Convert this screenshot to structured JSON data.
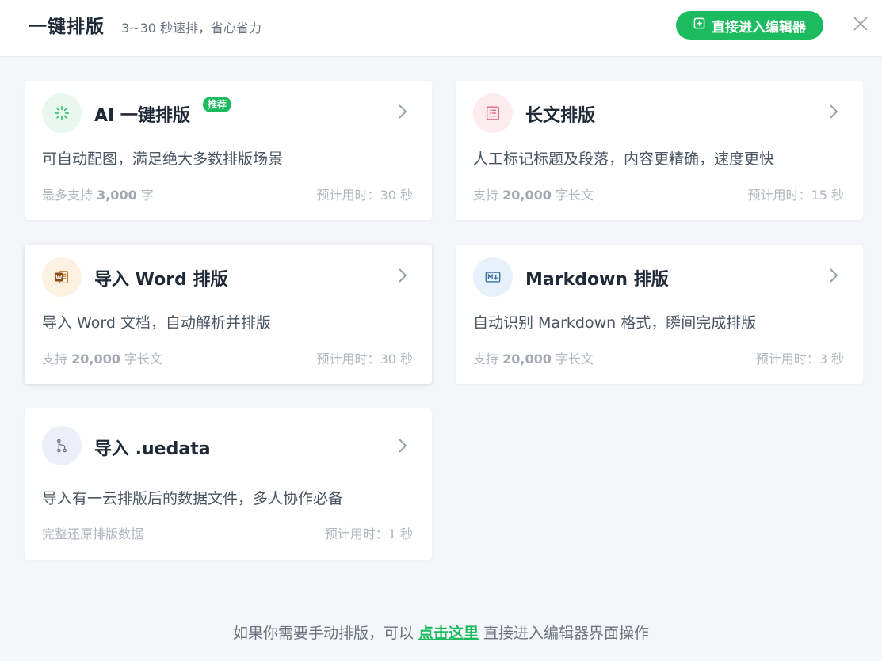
{
  "header": {
    "title": "一键排版",
    "subtitle": "3~30 秒速排，省心省力",
    "enter_editor_label": "直接进入编辑器"
  },
  "cards": [
    {
      "title": "AI 一键排版",
      "badge": "推荐",
      "description": "可自动配图，满足绝大多数排版场景",
      "meta_prefix": "最多支持 ",
      "meta_value": "3,000",
      "meta_suffix": " 字",
      "time": "预计用时：30 秒",
      "icon": "sparkle-icon",
      "icon_bg": "#e8f8ee",
      "icon_color": "#1dbb5f"
    },
    {
      "title": "长文排版",
      "description": "人工标记标题及段落，内容更精确，速度更快",
      "meta_prefix": "支持 ",
      "meta_value": "20,000",
      "meta_suffix": " 字长文",
      "time": "预计用时：15 秒",
      "icon": "list-document-icon",
      "icon_bg": "#fdecef",
      "icon_color": "#e46a85"
    },
    {
      "title": "导入 Word 排版",
      "description": "导入 Word 文档，自动解析并排版",
      "meta_prefix": "支持 ",
      "meta_value": "20,000",
      "meta_suffix": " 字长文",
      "time": "预计用时：30 秒",
      "icon": "word-icon",
      "icon_bg": "#fdf1e2",
      "icon_color": "#c4772b"
    },
    {
      "title": "Markdown 排版",
      "description": "自动识别 Markdown 格式，瞬间完成排版",
      "meta_prefix": "支持 ",
      "meta_value": "20,000",
      "meta_suffix": " 字长文",
      "time": "预计用时：3 秒",
      "icon": "markdown-icon",
      "icon_bg": "#e6f1fb",
      "icon_color": "#3b6fa0"
    },
    {
      "title": "导入 .uedata",
      "description": "导入有一云排版后的数据文件，多人协作必备",
      "meta_text": "完整还原排版数据",
      "time": "预计用时：1 秒",
      "icon": "merge-icon",
      "icon_bg": "#eceff8",
      "icon_color": "#6b7280"
    }
  ],
  "footer": {
    "prefix": "如果你需要手动排版，可以",
    "link": "点击这里",
    "suffix": "直接进入编辑器界面操作"
  },
  "colors": {
    "accent": "#1dbb5f",
    "background": "#f4f6f9"
  }
}
